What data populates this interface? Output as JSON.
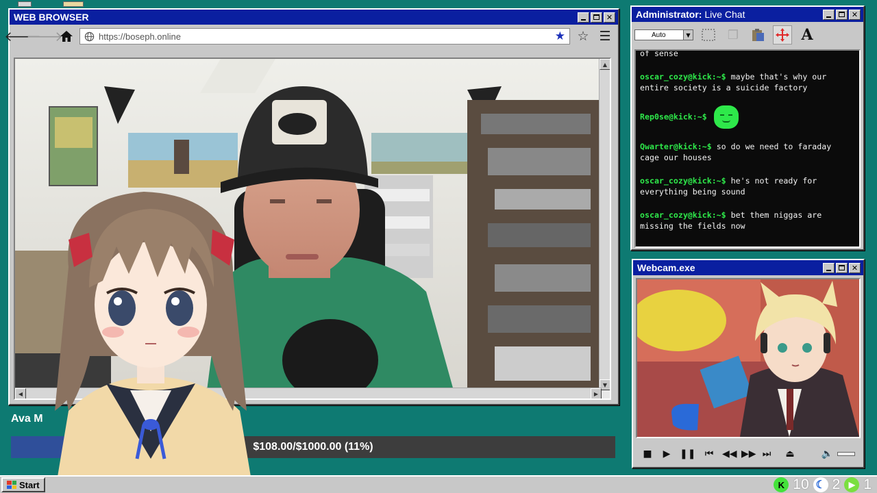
{
  "browser": {
    "title": "WEB BROWSER",
    "url": "https://boseph.online",
    "icons": {
      "back": "arrow-left-icon",
      "forward": "arrow-right-icon",
      "home": "home-icon",
      "globe": "globe-icon",
      "bookmark": "star-filled-icon",
      "favorite": "star-outline-icon",
      "menu": "hamburger-menu-icon"
    }
  },
  "chat": {
    "title_bold": "Administrator:",
    "title_rest": " Live Chat",
    "select_value": "Auto",
    "tools": [
      "marquee-select-icon",
      "copy-icon",
      "paste-icon",
      "move-icon",
      "font-icon"
    ],
    "font_tool_label": "A",
    "partial_line": "of sense",
    "messages": [
      {
        "user": "oscar_cozy@kick:~$",
        "text": "maybe that's why our entire society is a suicide factory"
      },
      {
        "user": "Rep0se@kick:~$",
        "text": "",
        "emote": "green-blob-emote"
      },
      {
        "user": "Qwarter@kick:~$",
        "text": "so do we need to faraday cage our houses"
      },
      {
        "user": "oscar_cozy@kick:~$",
        "text": "he's not ready for everything being sound"
      },
      {
        "user": "oscar_cozy@kick:~$",
        "text": "bet them niggas are missing the fields now"
      }
    ]
  },
  "webcam": {
    "title": "Webcam.exe",
    "controls": [
      "stop-icon",
      "play-icon",
      "pause-icon",
      "skip-back-icon",
      "rewind-icon",
      "fast-forward-icon",
      "skip-forward-icon",
      "eject-icon",
      "volume-icon"
    ]
  },
  "donation": {
    "name": "Ava M",
    "text": "$108.00/$1000.00 (11%)",
    "progress": 0.108
  },
  "taskbar": {
    "start_label": "Start",
    "tray": [
      {
        "icon": "kick-icon",
        "count": "10"
      },
      {
        "icon": "moon-icon",
        "count": "2"
      },
      {
        "icon": "rumble-icon",
        "count": "1"
      }
    ]
  },
  "colors": {
    "titlebar": "#0a1fa0",
    "desktop": "#0e7a72",
    "chat_user": "#2ee84a",
    "progress_fill": "#2f4f9a"
  }
}
